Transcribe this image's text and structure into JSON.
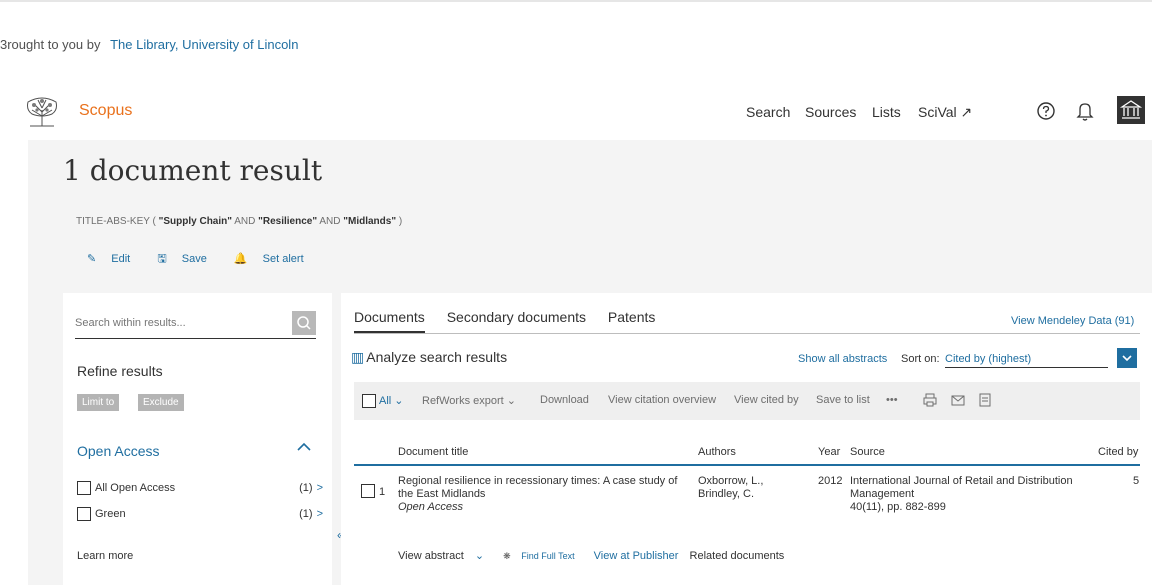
{
  "top": {
    "brought_prefix": "3rought to you by",
    "library": "The Library, University of Lincoln"
  },
  "header": {
    "brand": "Scopus",
    "nav": [
      "Search",
      "Sources",
      "Lists",
      "SciVal ↗"
    ],
    "icons": [
      "help-icon",
      "bell-icon",
      "institution-icon"
    ]
  },
  "results": {
    "title": "1 document result",
    "query": {
      "prefix": "TITLE-ABS-KEY (",
      "t1": "\"Supply Chain\"",
      "and1": "AND",
      "t2": "\"Resilience\"",
      "and2": "AND",
      "t3": "\"Midlands\"",
      "suffix": ")"
    },
    "actions": {
      "edit": "Edit",
      "save": "Save",
      "alert": "Set alert"
    }
  },
  "sidebar": {
    "search_placeholder": "Search within results...",
    "refine": "Refine results",
    "limit_to": "Limit to",
    "exclude": "Exclude",
    "open_access": {
      "heading": "Open Access",
      "items": [
        {
          "label": "All Open Access",
          "count": "(1)"
        },
        {
          "label": "Green",
          "count": "(1)"
        }
      ],
      "learn_more": "Learn more"
    }
  },
  "main": {
    "tabs": [
      "Documents",
      "Secondary documents",
      "Patents"
    ],
    "mendeley": "View Mendeley Data (91)",
    "analyze": "Analyze search results",
    "show_abstracts": "Show all abstracts",
    "sort_label": "Sort on:",
    "sort_value": "Cited by (highest)",
    "toolbar": {
      "all": "All",
      "refworks": "RefWorks export",
      "download": "Download",
      "citation": "View citation overview",
      "cited_by": "View cited by",
      "save_list": "Save to list",
      "more": "•••"
    },
    "columns": {
      "title": "Document title",
      "authors": "Authors",
      "year": "Year",
      "source": "Source",
      "cited": "Cited by"
    },
    "rows": [
      {
        "num": "1",
        "title_line1": "Regional resilience in recessionary times: A case study of",
        "title_line2": "the East Midlands",
        "oa": "Open Access",
        "authors_line1": "Oxborrow, L.,",
        "authors_line2": "Brindley, C.",
        "year": "2012",
        "source_line1": "International Journal of Retail and Distribution",
        "source_line2": "Management",
        "source_line3": "40(11), pp. 882-899",
        "cited": "5"
      }
    ],
    "row_links": {
      "abstract": "View abstract",
      "fft": "Find Full Text",
      "publisher": "View at Publisher",
      "related": "Related documents"
    }
  },
  "colors": {
    "brand": "#e9711c",
    "link": "#1f6ea0",
    "text": "#323232",
    "muted": "#6e6e6e"
  }
}
